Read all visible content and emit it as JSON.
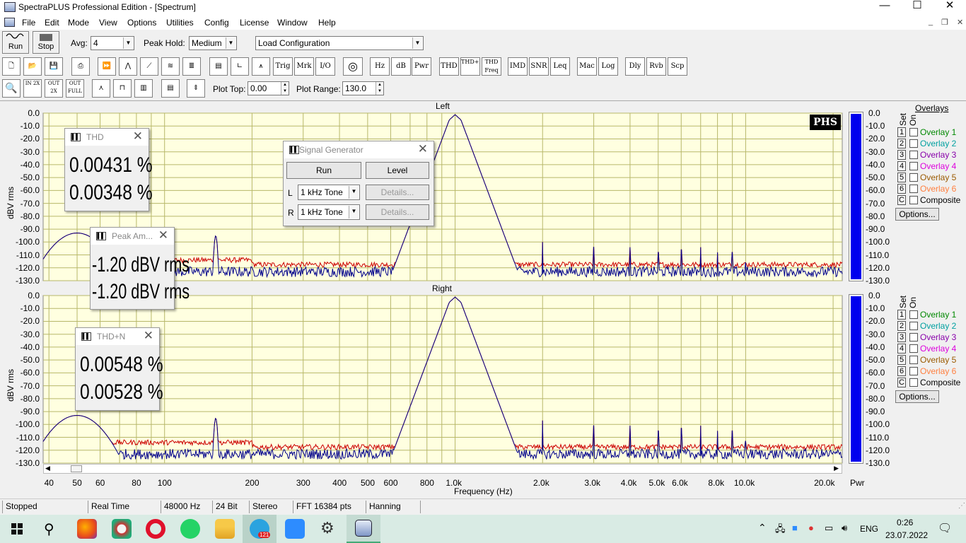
{
  "window": {
    "title": "SpectraPLUS Professional Edition - [Spectrum]"
  },
  "menu": [
    "File",
    "Edit",
    "Mode",
    "View",
    "Options",
    "Utilities",
    "Config",
    "License",
    "Window",
    "Help"
  ],
  "toolbar1": {
    "run_label": "Run",
    "stop_label": "Stop",
    "avg_label": "Avg:",
    "avg_value": "4",
    "peak_label": "Peak Hold:",
    "peak_value": "Medium",
    "config_value": "Load Configuration"
  },
  "toolbar2": {
    "buttons": [
      "Trig",
      "Mrk",
      "I/O",
      "Hz",
      "dB",
      "Pwr",
      "THD",
      "THD+N",
      "THD Freq",
      "IMD",
      "SNR",
      "Leq",
      "Mac",
      "Log",
      "Dly",
      "Rvb",
      "Scp"
    ]
  },
  "toolbar3": {
    "zoom_labels": [
      "IN 2X",
      "OUT 2X",
      "OUT FULL"
    ],
    "plot_top_label": "Plot Top:",
    "plot_top_value": "0.00",
    "plot_range_label": "Plot Range:",
    "plot_range_value": "130.0"
  },
  "plots": {
    "left_title": "Left",
    "right_title": "Right",
    "y_axis_label": "dBV rms",
    "x_axis_label": "Frequency (Hz)",
    "y_ticks": [
      "0.0",
      "-10.0",
      "-20.0",
      "-30.0",
      "-40.0",
      "-50.0",
      "-60.0",
      "-70.0",
      "-80.0",
      "-90.0",
      "-100.0",
      "-110.0",
      "-120.0",
      "-130.0"
    ],
    "x_ticks": [
      "40",
      "50",
      "60",
      "80",
      "100",
      "200",
      "300",
      "400",
      "500",
      "600",
      "800",
      "1.0k",
      "2.0k",
      "3.0k",
      "4.0k",
      "5.0k",
      "6.0k",
      "8.0k",
      "10.0k",
      "20.0k"
    ],
    "logo": "PHS",
    "colors": {
      "plot_bg": "#ffffe0",
      "grid": "#b7b76a",
      "trace_blue": "#00008b",
      "trace_red": "#cc0000",
      "meter": "#0000ee"
    },
    "meter_label": "Pwr"
  },
  "overlays": {
    "title": "Overlays",
    "set_label": "Set",
    "on_label": "On",
    "items": [
      {
        "num": "1",
        "label": "Overlay 1",
        "color": "#008800"
      },
      {
        "num": "2",
        "label": "Overlay 2",
        "color": "#00a0a0"
      },
      {
        "num": "3",
        "label": "Overlay 3",
        "color": "#8800aa"
      },
      {
        "num": "4",
        "label": "Overlay 4",
        "color": "#dd00dd"
      },
      {
        "num": "5",
        "label": "Overlay 5",
        "color": "#9a5a00"
      },
      {
        "num": "6",
        "label": "Overlay 6",
        "color": "#ff8040"
      },
      {
        "num": "C",
        "label": "Composite",
        "color": "#000000"
      }
    ],
    "options_label": "Options..."
  },
  "popups": {
    "thd": {
      "title": "THD",
      "values": [
        "0.00431 %",
        "0.00348 %"
      ]
    },
    "peak": {
      "title": "Peak Am...",
      "values": [
        "-1.20 dBV rms",
        "-1.20 dBV rms"
      ]
    },
    "thdn": {
      "title": "THD+N",
      "values": [
        "0.00548 %",
        "0.00528 %"
      ]
    },
    "siggen": {
      "title": "Signal Generator",
      "run_label": "Run",
      "level_label": "Level",
      "l_label": "L",
      "r_label": "R",
      "l_value": "1 kHz Tone",
      "r_value": "1 kHz Tone",
      "details_label": "Details..."
    }
  },
  "status": [
    "Stopped",
    "Real Time",
    "48000 Hz",
    "24 Bit",
    "Stereo",
    "FFT 16384 pts",
    "Hanning"
  ],
  "taskbar": {
    "lang": "ENG",
    "time": "0:26",
    "date": "23.07.2022",
    "telegram_badge": "121"
  }
}
